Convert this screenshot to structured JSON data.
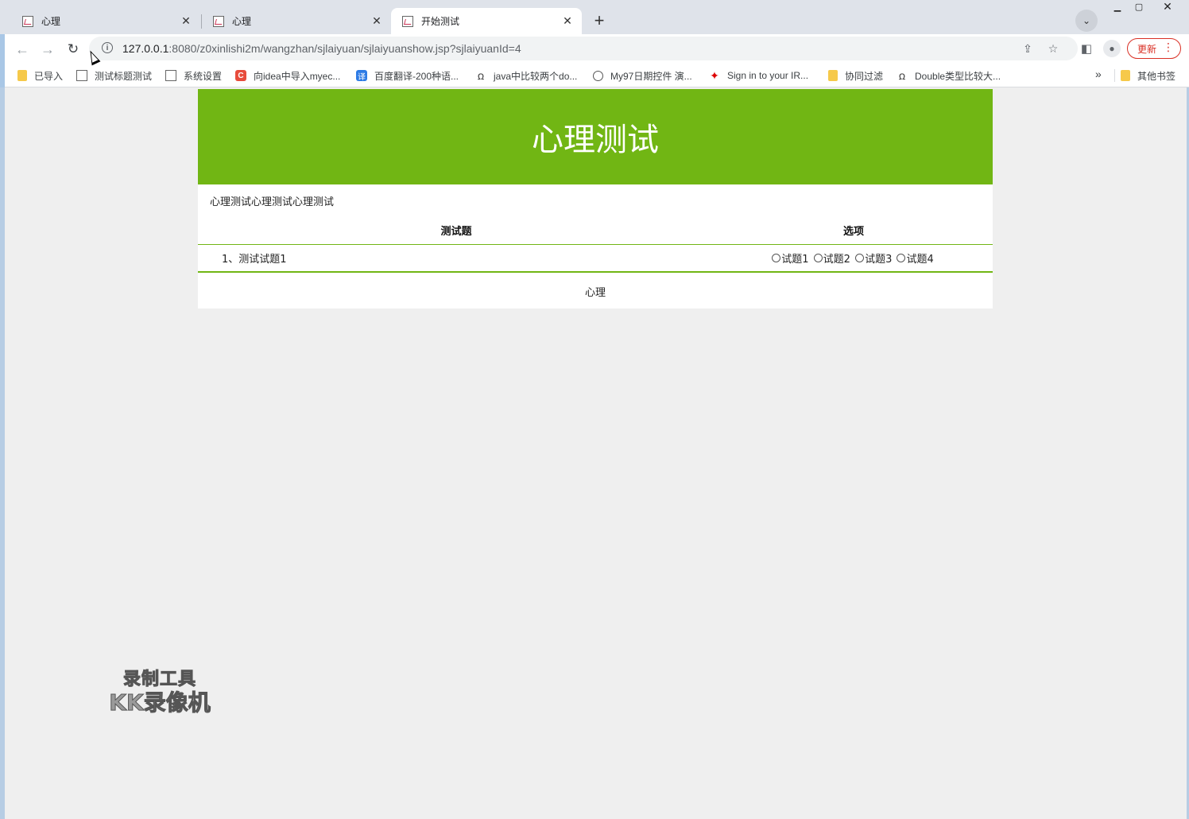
{
  "browser": {
    "tabs": [
      {
        "title": "心理",
        "active": false
      },
      {
        "title": "心理",
        "active": false
      },
      {
        "title": "开始测试",
        "active": true
      }
    ],
    "url_host": "127.0.0.1",
    "url_rest": ":8080/z0xinlishi2m/wangzhan/sjlaiyuan/sjlaiyuanshow.jsp?sjlaiyuanId=4",
    "update_label": "更新",
    "new_tab_glyph": "+",
    "accent_color": "#d93025"
  },
  "bookmarks": {
    "items": [
      {
        "label": "已导入",
        "icon": "folder-icon"
      },
      {
        "label": "测试标题测试",
        "icon": "image-icon"
      },
      {
        "label": "系统设置",
        "icon": "image-icon"
      },
      {
        "label": "向idea中导入myec...",
        "icon": "c-logo-icon"
      },
      {
        "label": "百度翻译-200种语...",
        "icon": "translate-icon"
      },
      {
        "label": "java中比较两个do...",
        "icon": "omega-icon"
      },
      {
        "label": "My97日期控件 演...",
        "icon": "globe-icon"
      },
      {
        "label": "Sign in to your IR...",
        "icon": "maple-leaf-icon"
      },
      {
        "label": "协同过滤",
        "icon": "folder-icon"
      },
      {
        "label": "Double类型比较大...",
        "icon": "omega-icon"
      }
    ],
    "more_glyph": "»",
    "other_label": "其他书签"
  },
  "page": {
    "banner_title": "心理测试",
    "banner_color": "#71b614",
    "intro_text": "心理测试心理测试心理测试",
    "table": {
      "headers": [
        "测试题",
        "选项"
      ],
      "rows": [
        {
          "question": "1、测试试题1",
          "options": [
            "试题1",
            "试题2",
            "试题3",
            "试题4"
          ]
        }
      ]
    },
    "footer_text": "心理"
  },
  "watermark": {
    "line1": "录制工具",
    "line2": "KK录像机"
  }
}
